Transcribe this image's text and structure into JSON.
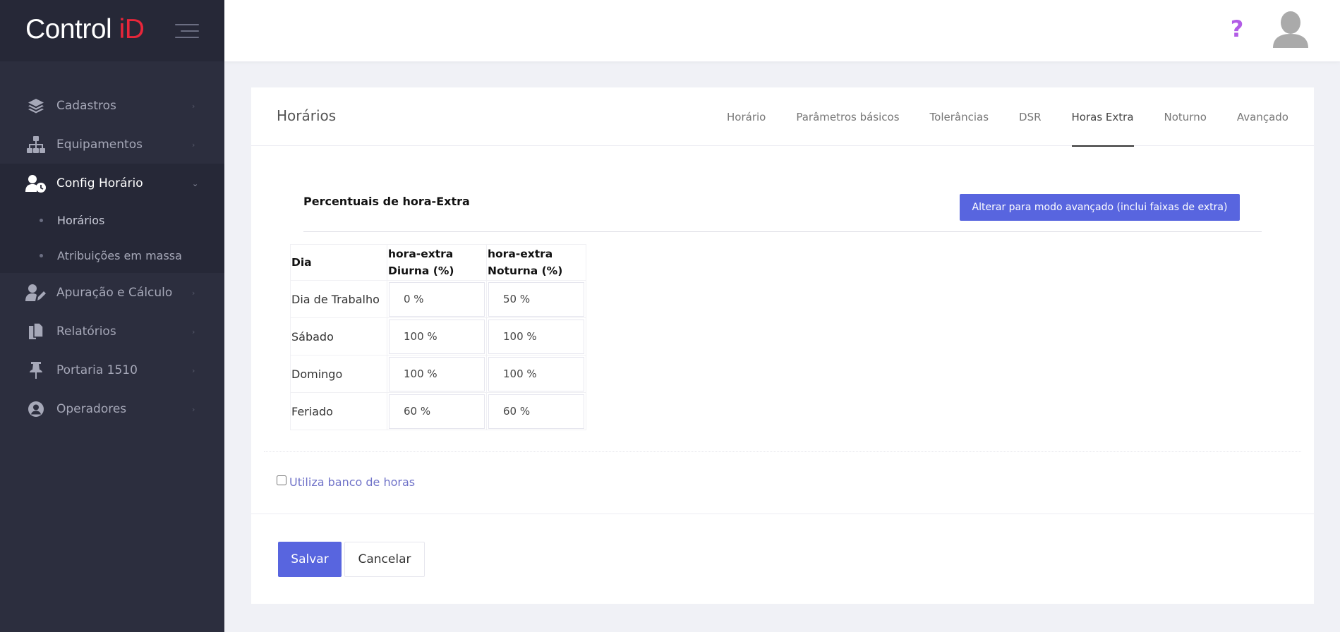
{
  "brand": {
    "text_main": "Control ",
    "text_accent": "iD"
  },
  "sidebar": {
    "items": [
      {
        "label": "Cadastros",
        "icon": "layers-icon"
      },
      {
        "label": "Equipamentos",
        "icon": "sitemap-icon"
      },
      {
        "label": "Config Horário",
        "icon": "user-clock-icon",
        "submenu": [
          {
            "label": "Horários"
          },
          {
            "label": "Atribuições em massa"
          }
        ]
      },
      {
        "label": "Apuração e Cálculo",
        "icon": "user-edit-icon"
      },
      {
        "label": "Relatórios",
        "icon": "copy-icon"
      },
      {
        "label": "Portaria 1510",
        "icon": "thumbtack-icon"
      },
      {
        "label": "Operadores",
        "icon": "user-circle-icon"
      }
    ]
  },
  "topbar": {
    "help_label": "?"
  },
  "card": {
    "title": "Horários",
    "tabs": [
      "Horário",
      "Parâmetros básicos",
      "Tolerâncias",
      "DSR",
      "Horas Extra",
      "Noturno",
      "Avançado"
    ],
    "active_tab": "Horas Extra"
  },
  "overtime": {
    "section_title": "Percentuais de hora-Extra",
    "advanced_button": "Alterar para modo avançado (inclui faixas de extra)",
    "headers": {
      "day": "Dia",
      "day_line1": "hora-extra",
      "day_line2": "Diurna (%)",
      "night_line1": "hora-extra",
      "night_line2": "Noturna (%)"
    },
    "rows": [
      {
        "day": "Dia de Trabalho",
        "diurna": "0 %",
        "noturna": "50 %"
      },
      {
        "day": "Sábado",
        "diurna": "100 %",
        "noturna": "100 %"
      },
      {
        "day": "Domingo",
        "diurna": "100 %",
        "noturna": "100 %"
      },
      {
        "day": "Feriado",
        "diurna": "60 %",
        "noturna": "60 %"
      }
    ]
  },
  "bank_hours": {
    "label": "Utiliza banco de horas",
    "checked": false
  },
  "actions": {
    "save": "Salvar",
    "cancel": "Cancelar"
  },
  "colors": {
    "primary": "#5865df",
    "sidebar_bg": "#2c2e3e",
    "brand_accent": "#e8263a",
    "help": "#b25ce6"
  }
}
